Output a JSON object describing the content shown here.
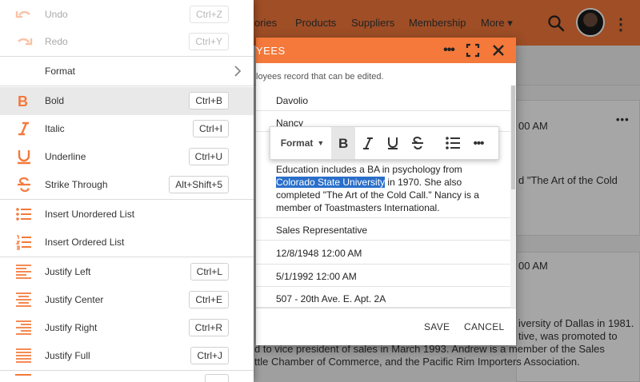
{
  "nav": {
    "items": [
      "ories",
      "Products",
      "Suppliers",
      "Membership",
      "More ▾"
    ]
  },
  "background": {
    "time_1": "00 AM",
    "text_1": "d \"The Art of the Cold",
    "time_2": "00 AM",
    "lines": [
      "iversity of Dallas in 1981.",
      "tive, was promoted to",
      "d to vice president of sales in March 1993. Andrew is a member of the Sales",
      "ttle Chamber of Commerce, and the Pacific Rim Importers Association."
    ],
    "card_more": "•••"
  },
  "dialog": {
    "title": "YEES",
    "subtitle": "loyees record that can be edited.",
    "fields": {
      "last_name": "Davolio",
      "first_name": "Nancy",
      "notes_before": "Education includes a BA in psychology from ",
      "notes_selected": "Colorado State University",
      "notes_after": " in 1970. She also completed \"The Art of the Cold Call.\" Nancy is a member of Toastmasters International.",
      "title": "Sales Representative",
      "birth_date": "12/8/1948 12:00 AM",
      "hire_date": "5/1/1992 12:00 AM",
      "address": "507 - 20th Ave. E. Apt. 2A"
    },
    "buttons": {
      "save": "SAVE",
      "cancel": "CANCEL"
    }
  },
  "toolbar": {
    "format_label": "Format"
  },
  "menu": {
    "items": [
      {
        "label": "Undo",
        "shortcut": "Ctrl+Z",
        "icon": "undo-icon",
        "disabled": true
      },
      {
        "label": "Redo",
        "shortcut": "Ctrl+Y",
        "icon": "redo-icon",
        "disabled": true
      },
      {
        "label": "Format",
        "shortcut": "",
        "icon": "",
        "submenu": true
      },
      {
        "label": "Bold",
        "shortcut": "Ctrl+B",
        "icon": "bold-icon"
      },
      {
        "label": "Italic",
        "shortcut": "Ctrl+I",
        "icon": "italic-icon"
      },
      {
        "label": "Underline",
        "shortcut": "Ctrl+U",
        "icon": "underline-icon"
      },
      {
        "label": "Strike Through",
        "shortcut": "Alt+Shift+5",
        "icon": "strikethrough-icon"
      },
      {
        "label": "Insert Unordered List",
        "shortcut": "",
        "icon": "unordered-list-icon"
      },
      {
        "label": "Insert Ordered List",
        "shortcut": "",
        "icon": "ordered-list-icon"
      },
      {
        "label": "Justify Left",
        "shortcut": "Ctrl+L",
        "icon": "justify-left-icon"
      },
      {
        "label": "Justify Center",
        "shortcut": "Ctrl+E",
        "icon": "justify-center-icon"
      },
      {
        "label": "Justify Right",
        "shortcut": "Ctrl+R",
        "icon": "justify-right-icon"
      },
      {
        "label": "Justify Full",
        "shortcut": "Ctrl+J",
        "icon": "justify-full-icon"
      }
    ]
  },
  "colors": {
    "accent": "#f4793b",
    "selection": "#2a6fc9"
  }
}
